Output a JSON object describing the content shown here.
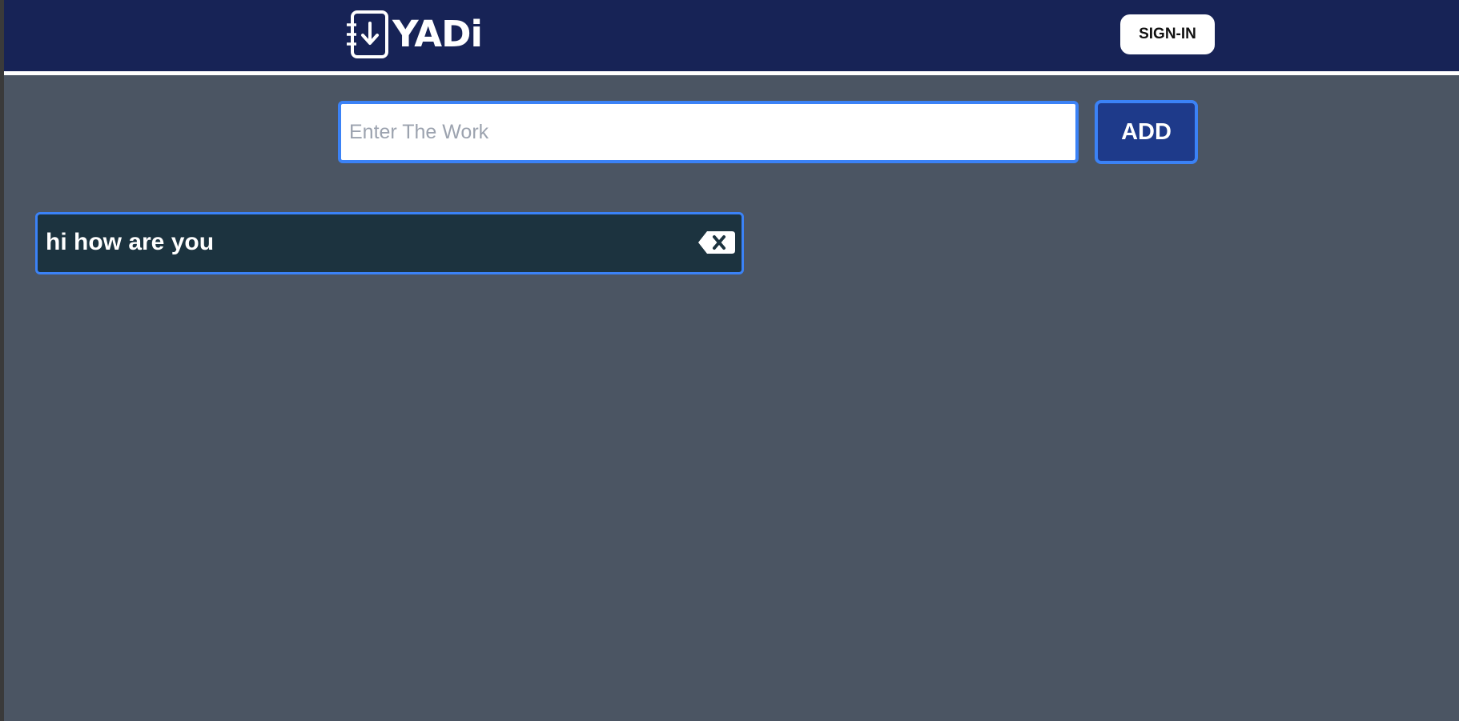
{
  "header": {
    "brand": "YADi",
    "logo_icon": "notebook-download-icon",
    "signin_label": "SIGN-IN"
  },
  "form": {
    "placeholder": "Enter The Work",
    "value": "",
    "add_label": "ADD"
  },
  "todos": [
    {
      "text": "hi how are you",
      "delete_icon": "backspace-delete-icon"
    }
  ],
  "colors": {
    "navbar": "#172356",
    "page_background": "#4b5563",
    "accent_border": "#3b82f6",
    "add_button": "#1e3a8a",
    "todo_background": "#1c333f"
  }
}
